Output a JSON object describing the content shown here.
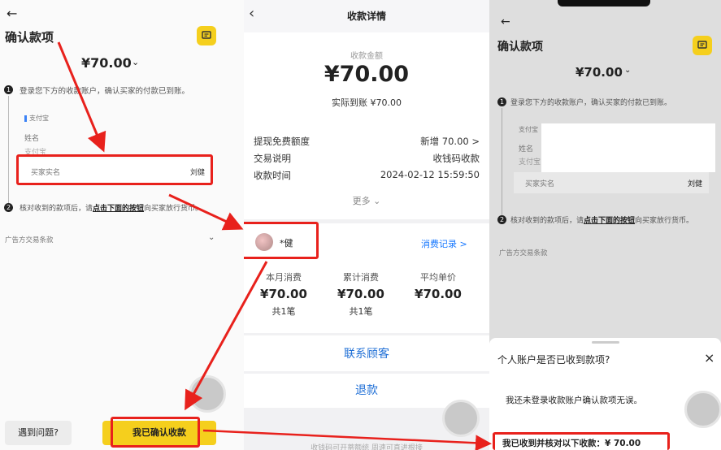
{
  "panel1": {
    "back_icon": "arrow-left-icon",
    "title": "确认款项",
    "chat_icon": "chat-icon",
    "amount": "¥70.00",
    "step1_text": "登录您下方的收款账户，确认买家的付款已到账。",
    "pay_label": "支付宝",
    "name_label": "姓名",
    "account_label": "支付宝",
    "buyer_name_placeholder": "买家实名",
    "buyer_name_value": "刘健",
    "step2_pre": "核对收到的款项后，请",
    "step2_link": "点击下面的按钮",
    "step2_post": "向买家放行货币。",
    "ad_terms": "广告方交易条款",
    "problem_button": "遇到问题?",
    "confirm_button": "我已确认收款"
  },
  "panel2": {
    "header_title": "收款详情",
    "amount_label": "收款金额",
    "amount": "¥70.00",
    "actual_label": "实际到账",
    "actual_value": "¥70.00",
    "rows": [
      {
        "label": "提现免费额度",
        "value": "新增 70.00 >"
      },
      {
        "label": "交易说明",
        "value": "收钱码收款"
      },
      {
        "label": "收款时间",
        "value": "2024-02-12 15:59:50"
      }
    ],
    "more": "更多",
    "payer_name": "*健",
    "records_link": "消费记录 >",
    "stats": [
      {
        "label": "本月消费",
        "value": "¥70.00",
        "count": "共1笔"
      },
      {
        "label": "累计消费",
        "value": "¥70.00",
        "count": "共1笔"
      },
      {
        "label": "平均单价",
        "value": "¥70.00",
        "count": ""
      }
    ],
    "contact": "联系顾客",
    "refund": "退款",
    "footer": "收钱码可开蒂额统 周速可直进根接"
  },
  "panel3": {
    "title": "确认款项",
    "amount": "¥70.00",
    "step1_text": "登录您下方的收款账户，确认买家的付款已到账。",
    "pay_label": "支付宝",
    "name_label": "姓名",
    "account_label": "支付宝",
    "buyer_name_placeholder": "买家实名",
    "buyer_name_value": "刘健",
    "step2_pre": "核对收到的款项后，请",
    "step2_link": "点击下面的按钮",
    "step2_post": "向买家放行货币。",
    "ad_terms": "广告方交易条款",
    "sheet_title": "个人账户是否已收到款项?",
    "sheet_close": "×",
    "sheet_option1": "我还未登录收款账户确认款项无误。",
    "sheet_option2": "我已收到并核对以下收款：¥ 70.00"
  },
  "colors": {
    "accent_yellow": "#f5cf1d",
    "annotation_red": "#e8211c",
    "link_blue": "#1677ff"
  }
}
